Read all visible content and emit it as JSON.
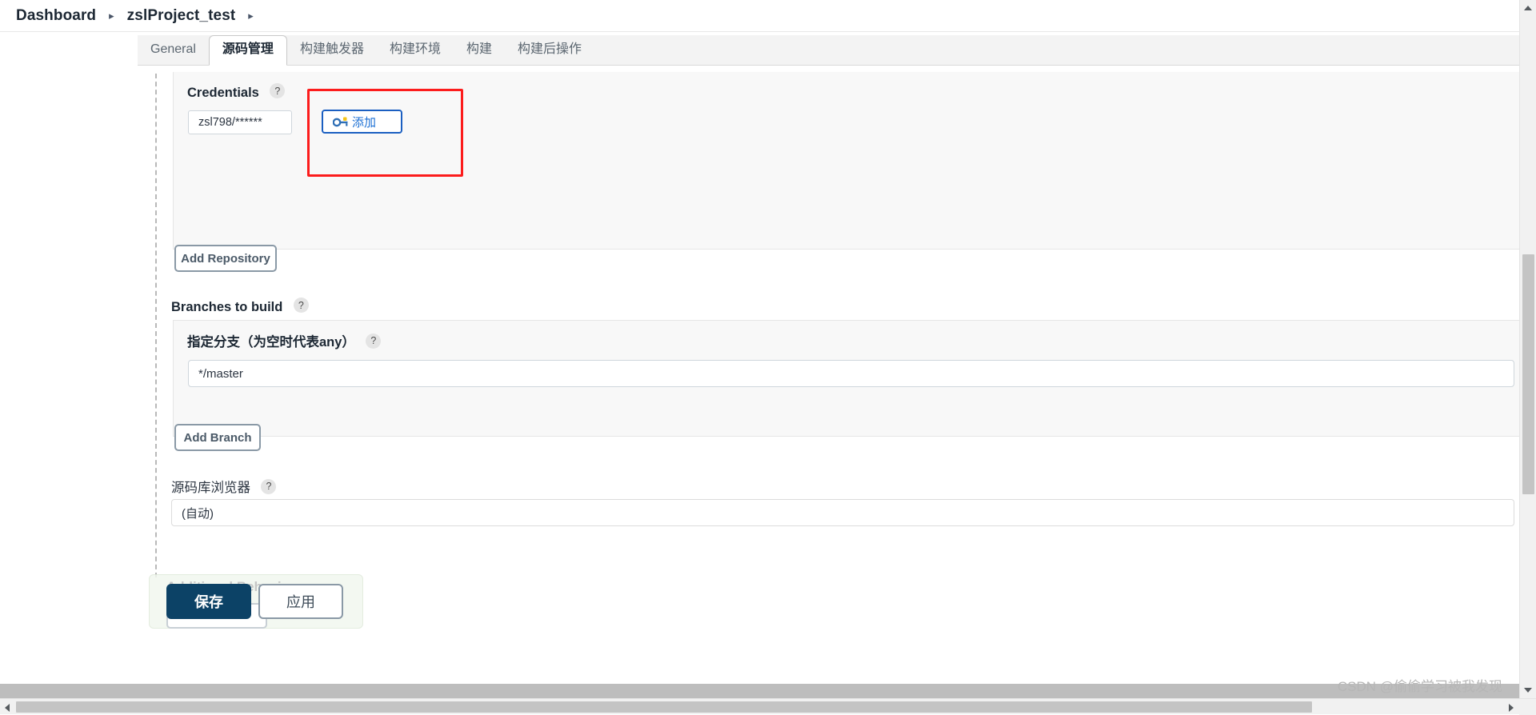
{
  "breadcrumb": {
    "items": [
      "Dashboard",
      "zslProject_test"
    ],
    "separator": "▸",
    "trailing_separator": "▸"
  },
  "tabs": [
    {
      "label": "General",
      "active": false
    },
    {
      "label": "源码管理",
      "active": true
    },
    {
      "label": "构建触发器",
      "active": false
    },
    {
      "label": "构建环境",
      "active": false
    },
    {
      "label": "构建",
      "active": false
    },
    {
      "label": "构建后操作",
      "active": false
    }
  ],
  "form": {
    "credentials": {
      "label": "Credentials",
      "help": "?",
      "selected_value": "zsl798/******",
      "dropdown_caret": "▼",
      "add_button": {
        "label": "添加",
        "icon": "key-icon",
        "caret": "▼"
      }
    },
    "add_repository_button": "Add Repository",
    "branches_to_build": {
      "label": "Branches to build",
      "help": "?",
      "branch_specifier": {
        "label": "指定分支（为空时代表any）",
        "help": "?",
        "value": "*/master"
      }
    },
    "add_branch_button": "Add Branch",
    "repository_browser": {
      "label": "源码库浏览器",
      "help": "?",
      "selected_value": "(自动)"
    },
    "additional_behaviours": {
      "label": "Additional Behaviours"
    }
  },
  "action_bar": {
    "save_label": "保存",
    "apply_label": "应用"
  },
  "annotation": {
    "highlight_color": "#fc1c1c",
    "target": "add-credentials-button"
  },
  "watermark": "CSDN @偷偷学习被我发现",
  "colors": {
    "accent_blue": "#1b6fd4",
    "save_navy": "#0c4266",
    "button_border_gray": "#8a99a6",
    "highlight_red": "#fc1c1c"
  }
}
